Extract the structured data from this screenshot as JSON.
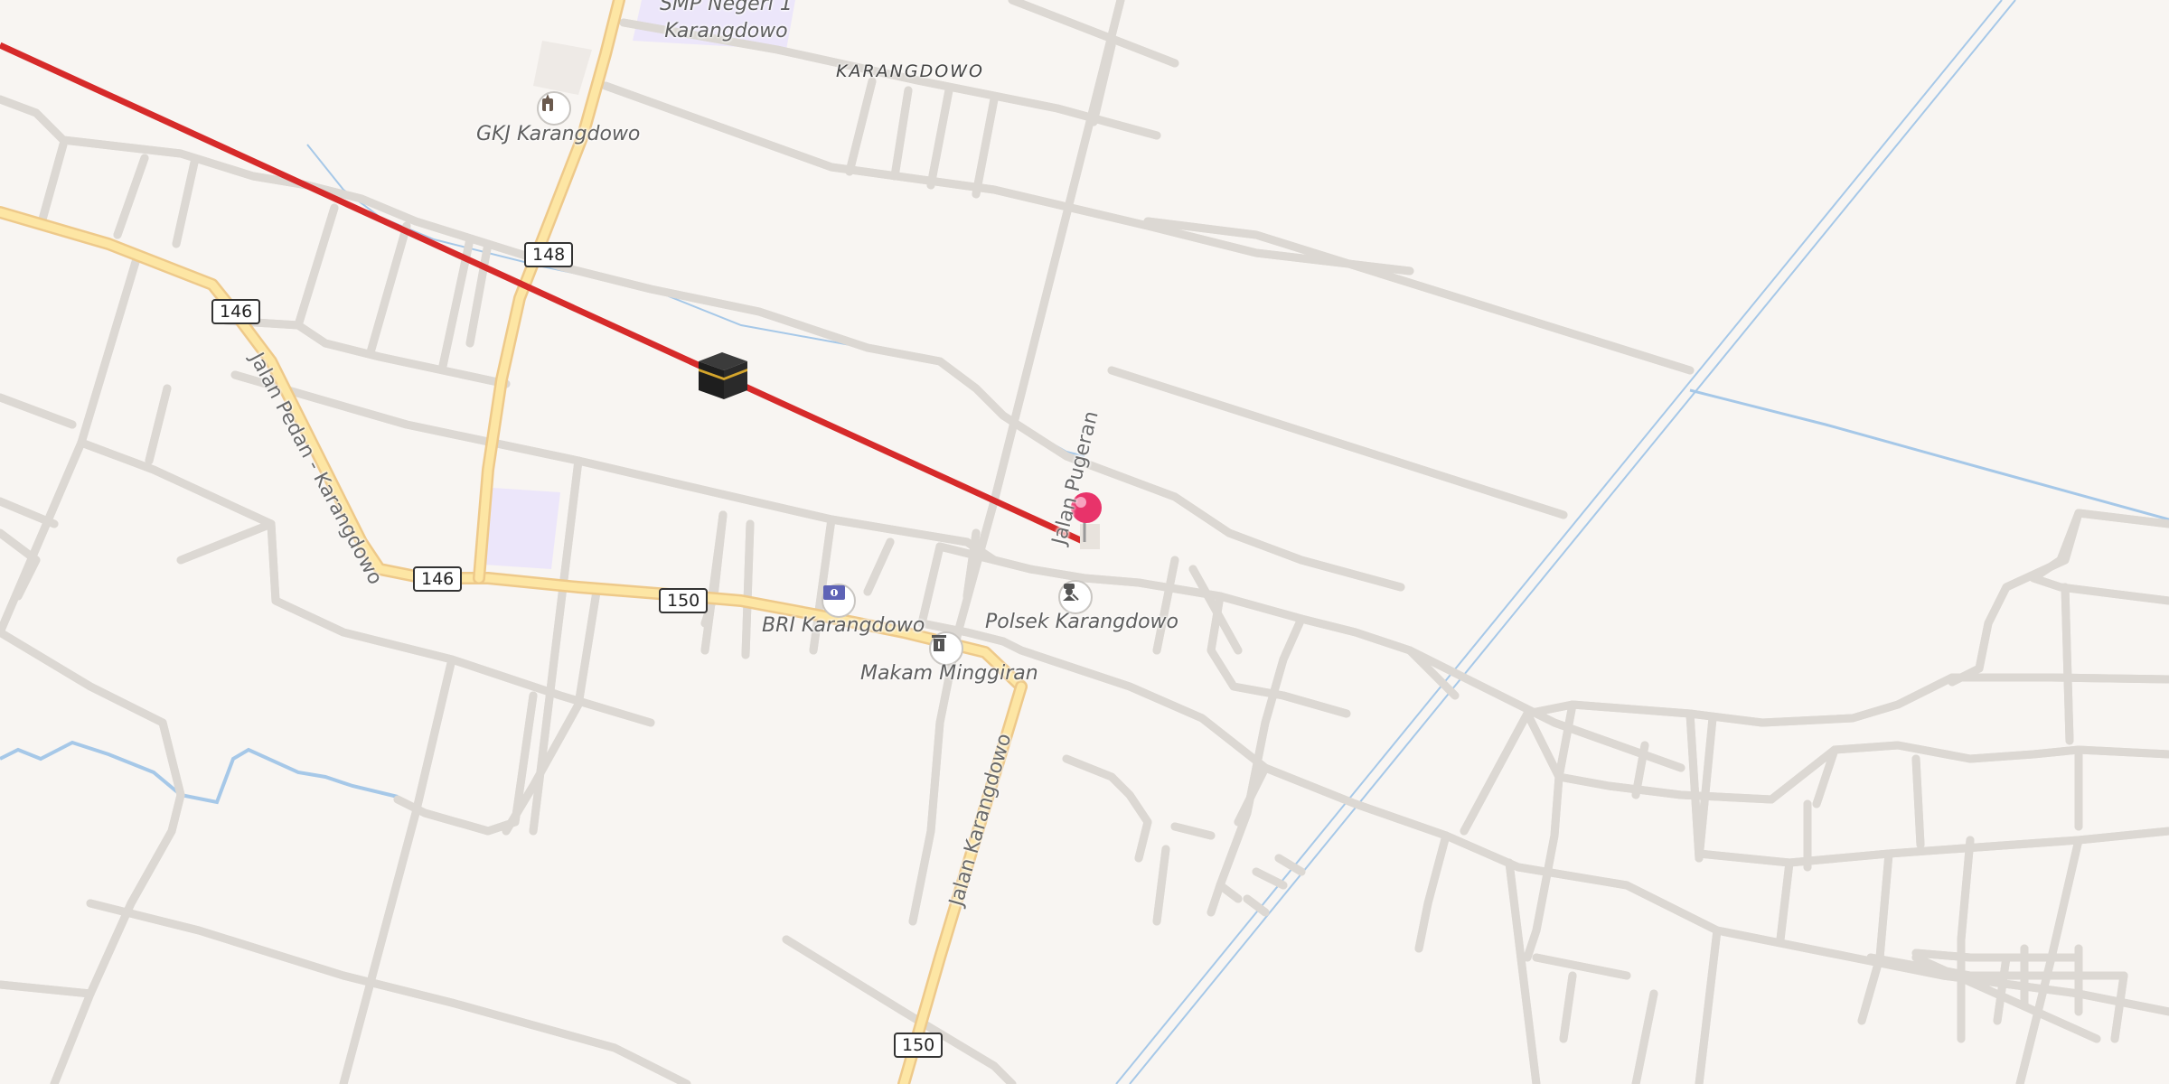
{
  "map": {
    "places": {
      "karangdowo": "KARANGDOWO"
    },
    "pois": {
      "smp": "SMP Negeri 1\nKarangdowo",
      "gkj": "GKJ Karangdowo",
      "bri": "BRI Karangdowo",
      "polsek": "Polsek Karangdowo",
      "makam": "Makam Minggiran"
    },
    "streets": {
      "pedan": "Jalan Pedan - Karangdowo",
      "pugeran": "Jalan Pugeran",
      "karangdowo": "Jalan Karangdowo"
    },
    "route_shields": {
      "s148": "148",
      "s146a": "146",
      "s146b": "146",
      "s150a": "150",
      "s150b": "150"
    },
    "colors": {
      "background": "#f8f5f2",
      "minor_road": "#ffffff",
      "road_casing": "#dcd8d3",
      "main_road": "#fde6a4",
      "main_road_casing": "#eec98a",
      "water": "#a6c8e8",
      "qibla_line": "#d62a2a",
      "pin": "#e8336a",
      "school_area": "#ece6fa"
    },
    "icons": {
      "gkj": "church-icon",
      "bri": "bank-icon",
      "polsek": "police-icon",
      "makam": "cemetery-icon",
      "kaaba": "kaaba-icon",
      "pin": "location-pin-icon"
    }
  }
}
